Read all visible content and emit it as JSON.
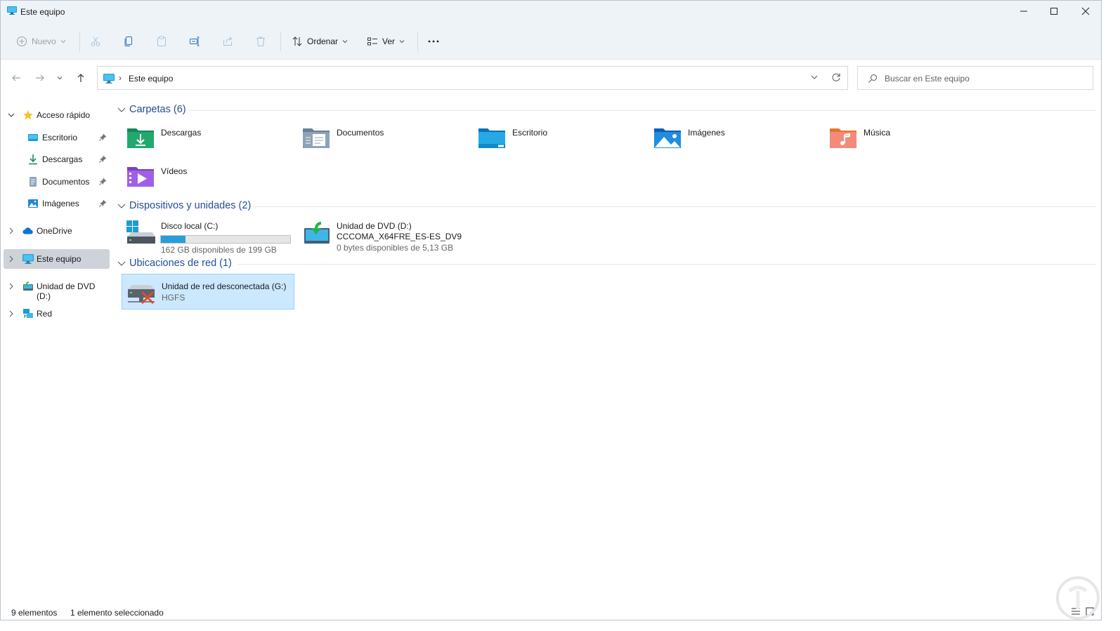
{
  "window": {
    "title": "Este equipo"
  },
  "toolbar": {
    "new_label": "Nuevo",
    "sort_label": "Ordenar",
    "view_label": "Ver",
    "more_label": "···",
    "icons": [
      "add-icon",
      "cut-icon",
      "copy-icon",
      "paste-icon",
      "rename-icon",
      "share-icon",
      "delete-icon",
      "sort-icon",
      "view-icon",
      "more-icon"
    ]
  },
  "address": {
    "path": "Este equipo",
    "search_placeholder": "Buscar en Este equipo"
  },
  "sidebar": {
    "items": [
      {
        "label": "Acceso rápido",
        "icon": "star-icon"
      },
      {
        "label": "Escritorio",
        "icon": "desktop-icon",
        "pinned": true
      },
      {
        "label": "Descargas",
        "icon": "download-icon",
        "pinned": true
      },
      {
        "label": "Documentos",
        "icon": "document-icon",
        "pinned": true
      },
      {
        "label": "Imágenes",
        "icon": "pictures-icon",
        "pinned": true
      },
      {
        "label": "OneDrive",
        "icon": "cloud-icon"
      },
      {
        "label": "Este equipo",
        "icon": "computer-icon",
        "selected": true
      },
      {
        "label": "Unidad de DVD (D:)",
        "icon": "dvd-icon"
      },
      {
        "label": "Red",
        "icon": "network-icon"
      }
    ]
  },
  "sections": {
    "folders": {
      "title": "Carpetas (6)",
      "items": [
        {
          "name": "Descargas",
          "icon": "downloads-folder-icon"
        },
        {
          "name": "Documentos",
          "icon": "documents-folder-icon"
        },
        {
          "name": "Escritorio",
          "icon": "desktop-folder-icon"
        },
        {
          "name": "Imágenes",
          "icon": "pictures-folder-icon"
        },
        {
          "name": "Música",
          "icon": "music-folder-icon"
        },
        {
          "name": "Vídeos",
          "icon": "videos-folder-icon"
        }
      ]
    },
    "devices": {
      "title": "Dispositivos y unidades (2)",
      "items": [
        {
          "name": "Disco local (C:)",
          "free": "162 GB disponibles de 199 GB",
          "used_fraction": 0.19,
          "icon": "local-disk-icon"
        },
        {
          "name": "Unidad de DVD (D:)",
          "label": "CCCOMA_X64FRE_ES-ES_DV9",
          "free": "0 bytes disponibles de 5,13 GB",
          "icon": "dvd-drive-icon"
        }
      ]
    },
    "network": {
      "title": "Ubicaciones de red (1)",
      "items": [
        {
          "name": "Unidad de red desconectada (G:)",
          "sub": "HGFS",
          "icon": "disconnected-network-drive-icon",
          "selected": true
        }
      ]
    }
  },
  "status": {
    "count": "9 elementos",
    "selection": "1 elemento seleccionado"
  },
  "colors": {
    "accent": "#1f4e99",
    "selection": "#cce8ff",
    "drive_fill": "#26a0da"
  }
}
